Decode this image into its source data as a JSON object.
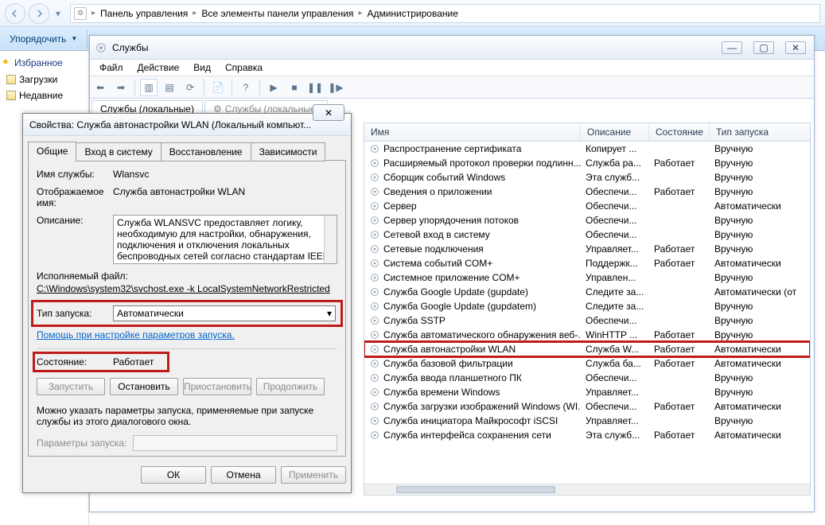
{
  "breadcrumbs": {
    "seg1": "Панель управления",
    "seg2": "Все элементы панели управления",
    "seg3": "Администрирование"
  },
  "explorer": {
    "organize": "Упорядочить",
    "favorites": "Избранное",
    "downloads": "Загрузки",
    "recent": "Недавние"
  },
  "services_window": {
    "title": "Службы",
    "menu": {
      "file": "Файл",
      "action": "Действие",
      "view": "Вид",
      "help": "Справка"
    },
    "left_tab": "Службы (локальные)",
    "left_tab2": "Службы (локальные)",
    "columns": {
      "name": "Имя",
      "desc": "Описание",
      "state": "Состояние",
      "startup": "Тип запуска"
    },
    "rows": [
      {
        "n": "Распространение сертификата",
        "d": "Копирует ...",
        "s": "",
        "t": "Вручную"
      },
      {
        "n": "Расширяемый протокол проверки подлинн...",
        "d": "Служба ра...",
        "s": "Работает",
        "t": "Вручную"
      },
      {
        "n": "Сборщик событий Windows",
        "d": "Эта служб...",
        "s": "",
        "t": "Вручную"
      },
      {
        "n": "Сведения о приложении",
        "d": "Обеспечи...",
        "s": "Работает",
        "t": "Вручную"
      },
      {
        "n": "Сервер",
        "d": "Обеспечи...",
        "s": "",
        "t": "Автоматически"
      },
      {
        "n": "Сервер упорядочения потоков",
        "d": "Обеспечи...",
        "s": "",
        "t": "Вручную"
      },
      {
        "n": "Сетевой вход в систему",
        "d": "Обеспечи...",
        "s": "",
        "t": "Вручную"
      },
      {
        "n": "Сетевые подключения",
        "d": "Управляет...",
        "s": "Работает",
        "t": "Вручную"
      },
      {
        "n": "Система событий COM+",
        "d": "Поддержк...",
        "s": "Работает",
        "t": "Автоматически"
      },
      {
        "n": "Системное приложение COM+",
        "d": "Управлен...",
        "s": "",
        "t": "Вручную"
      },
      {
        "n": "Служба Google Update (gupdate)",
        "d": "Следите за...",
        "s": "",
        "t": "Автоматически (от"
      },
      {
        "n": "Служба Google Update (gupdatem)",
        "d": "Следите за...",
        "s": "",
        "t": "Вручную"
      },
      {
        "n": "Служба SSTP",
        "d": "Обеспечи...",
        "s": "",
        "t": "Вручную"
      },
      {
        "n": "Служба автоматического обнаружения веб-...",
        "d": "WinHTTP ...",
        "s": "Работает",
        "t": "Вручную"
      },
      {
        "n": "Служба автонастройки WLAN",
        "d": "Служба W...",
        "s": "Работает",
        "t": "Автоматически",
        "hl": true
      },
      {
        "n": "Служба базовой фильтрации",
        "d": "Служба ба...",
        "s": "Работает",
        "t": "Автоматически"
      },
      {
        "n": "Служба ввода планшетного ПК",
        "d": "Обеспечи...",
        "s": "",
        "t": "Вручную"
      },
      {
        "n": "Служба времени Windows",
        "d": "Управляет...",
        "s": "",
        "t": "Вручную"
      },
      {
        "n": "Служба загрузки изображений Windows (WI...",
        "d": "Обеспечи...",
        "s": "Работает",
        "t": "Автоматически"
      },
      {
        "n": "Служба инициатора Майкрософт iSCSI",
        "d": "Управляет...",
        "s": "",
        "t": "Вручную"
      },
      {
        "n": "Служба интерфейса сохранения сети",
        "d": "Эта служб...",
        "s": "Работает",
        "t": "Автоматически"
      }
    ]
  },
  "props": {
    "title": "Свойства: Служба автонастройки WLAN (Локальный компьют...",
    "tabs": {
      "general": "Общие",
      "logon": "Вход в систему",
      "recovery": "Восстановление",
      "deps": "Зависимости"
    },
    "row_service_name": {
      "label": "Имя службы:",
      "value": "Wlansvc"
    },
    "row_display_name": {
      "label": "Отображаемое имя:",
      "value": "Служба автонастройки WLAN"
    },
    "row_desc": {
      "label": "Описание:",
      "value": "Служба WLANSVC предоставляет логику, необходимую для настройки, обнаружения, подключения и отключения локальных беспроводных сетей согласно стандартам IEEE"
    },
    "exe_label": "Исполняемый файл:",
    "exe_path": "C:\\Windows\\system32\\svchost.exe -k LocalSystemNetworkRestricted",
    "start_label": "Тип запуска:",
    "start_value": "Автоматически",
    "help_link": "Помощь при настройке параметров запуска.",
    "state_label": "Состояние:",
    "state_value": "Работает",
    "btn_start": "Запустить",
    "btn_stop": "Остановить",
    "btn_pause": "Приостановить",
    "btn_resume": "Продолжить",
    "note": "Можно указать параметры запуска, применяемые при запуске службы из этого диалогового окна.",
    "params_label": "Параметры запуска:",
    "ok": "ОК",
    "cancel": "Отмена",
    "apply": "Применить"
  }
}
